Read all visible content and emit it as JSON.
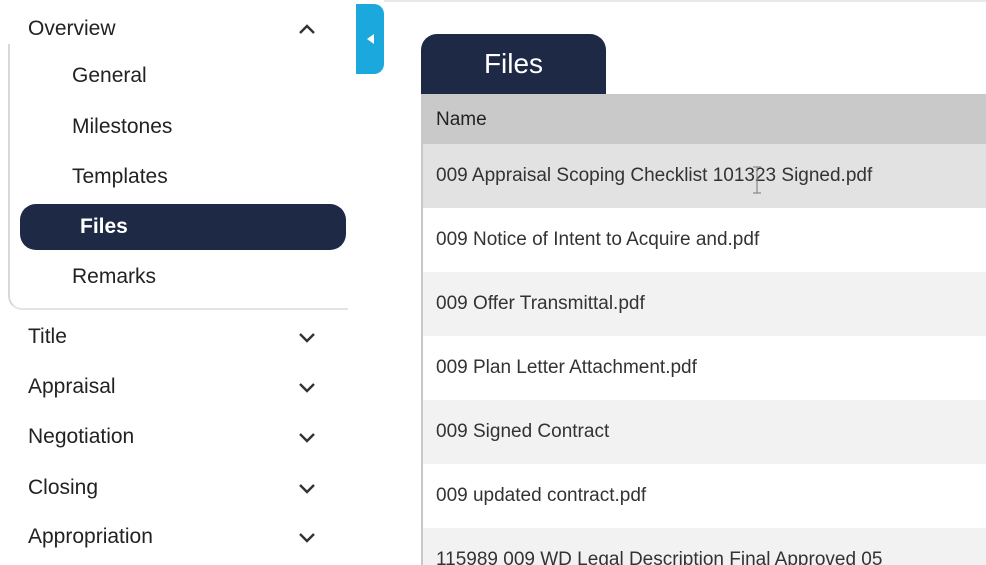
{
  "sidebar": {
    "sections": [
      {
        "label": "Overview",
        "expanded": true,
        "chevron": "chevron-up-icon"
      },
      {
        "label": "Title",
        "expanded": false,
        "chevron": "chevron-down-icon"
      },
      {
        "label": "Appraisal",
        "expanded": false,
        "chevron": "chevron-down-icon"
      },
      {
        "label": "Negotiation",
        "expanded": false,
        "chevron": "chevron-down-icon"
      },
      {
        "label": "Closing",
        "expanded": false,
        "chevron": "chevron-down-icon"
      },
      {
        "label": "Appropriation",
        "expanded": false,
        "chevron": "chevron-down-icon"
      }
    ],
    "overview_items": [
      {
        "label": "General"
      },
      {
        "label": "Milestones"
      },
      {
        "label": "Templates"
      },
      {
        "label": "Files",
        "active": true
      },
      {
        "label": "Remarks"
      }
    ]
  },
  "collapse_tab": {
    "icon": "caret-left-icon",
    "color": "#1ba9dd"
  },
  "main": {
    "tab_label": "Files",
    "column_header": "Name",
    "files": [
      "009 Appraisal Scoping Checklist 101323 Signed.pdf",
      "009 Notice of Intent to Acquire and.pdf",
      "009 Offer Transmittal.pdf",
      "009 Plan Letter Attachment.pdf",
      "009 Signed Contract",
      "009 updated contract.pdf",
      "115989 009 WD Legal Description Final Approved 05"
    ]
  },
  "colors": {
    "navy": "#1e2a45",
    "accent": "#1ba9dd",
    "header_gray": "#c9c9c9",
    "row_alt": "#f2f2f2"
  }
}
